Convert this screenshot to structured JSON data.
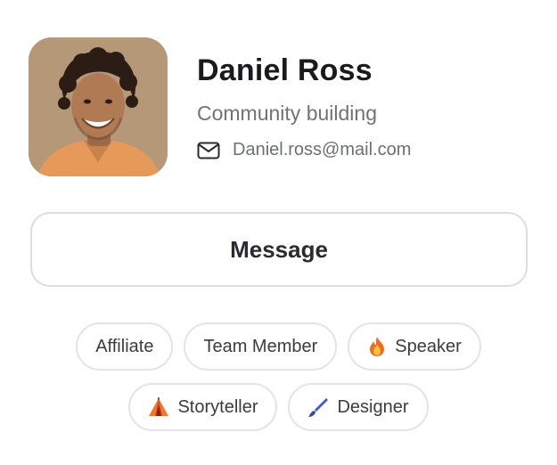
{
  "profile": {
    "name": "Daniel Ross",
    "role": "Community building",
    "email": "Daniel.ross@mail.com"
  },
  "actions": {
    "message_label": "Message"
  },
  "tags": {
    "row1": [
      {
        "label": "Affiliate",
        "icon": null
      },
      {
        "label": "Team Member",
        "icon": null
      },
      {
        "label": "Speaker",
        "icon": "fire-icon"
      }
    ],
    "row2": [
      {
        "label": "Storyteller",
        "icon": "tent-icon"
      },
      {
        "label": "Designer",
        "icon": "paintbrush-icon"
      }
    ]
  },
  "colors": {
    "name_text": "#1b1b1f",
    "muted_text": "#6e7379",
    "border": "#dcdde0",
    "avatar_bg": "#b79a7c"
  }
}
